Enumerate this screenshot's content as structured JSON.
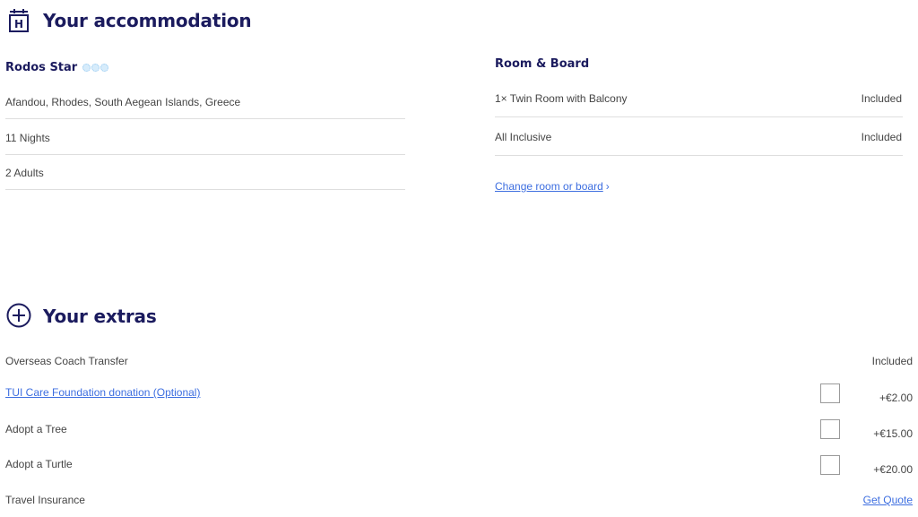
{
  "accommodation": {
    "title": "Your accommodation",
    "hotel_name": "Rodos Star",
    "hotel_rating": 3,
    "location": "Afandou, Rhodes, South Aegean Islands, Greece",
    "nights": "11 Nights",
    "guests": "2  Adults"
  },
  "room_board": {
    "title": "Room & Board",
    "items": [
      {
        "label": "1× Twin Room with Balcony",
        "status": "Included"
      },
      {
        "label": "All Inclusive",
        "status": "Included"
      }
    ],
    "change_link": "Change room or board",
    "change_chevron": "›"
  },
  "extras": {
    "title": "Your extras",
    "items": [
      {
        "label": "Overseas Coach Transfer",
        "value": "Included"
      },
      {
        "label": "TUI Care Foundation donation (Optional)",
        "value": "+€2.00"
      },
      {
        "label": "Adopt a Tree",
        "value": "+€15.00"
      },
      {
        "label": "Adopt a Turtle",
        "value": "+€20.00"
      },
      {
        "label": "Travel Insurance",
        "value": "Get Quote"
      }
    ]
  },
  "colors": {
    "heading": "#1b1b5e",
    "link": "#3d6ee0",
    "text": "#444444",
    "divider": "#dedede"
  },
  "icons": {
    "accommodation": "hotel-icon",
    "extras": "plus-circle-icon",
    "rating": "star-icon"
  }
}
